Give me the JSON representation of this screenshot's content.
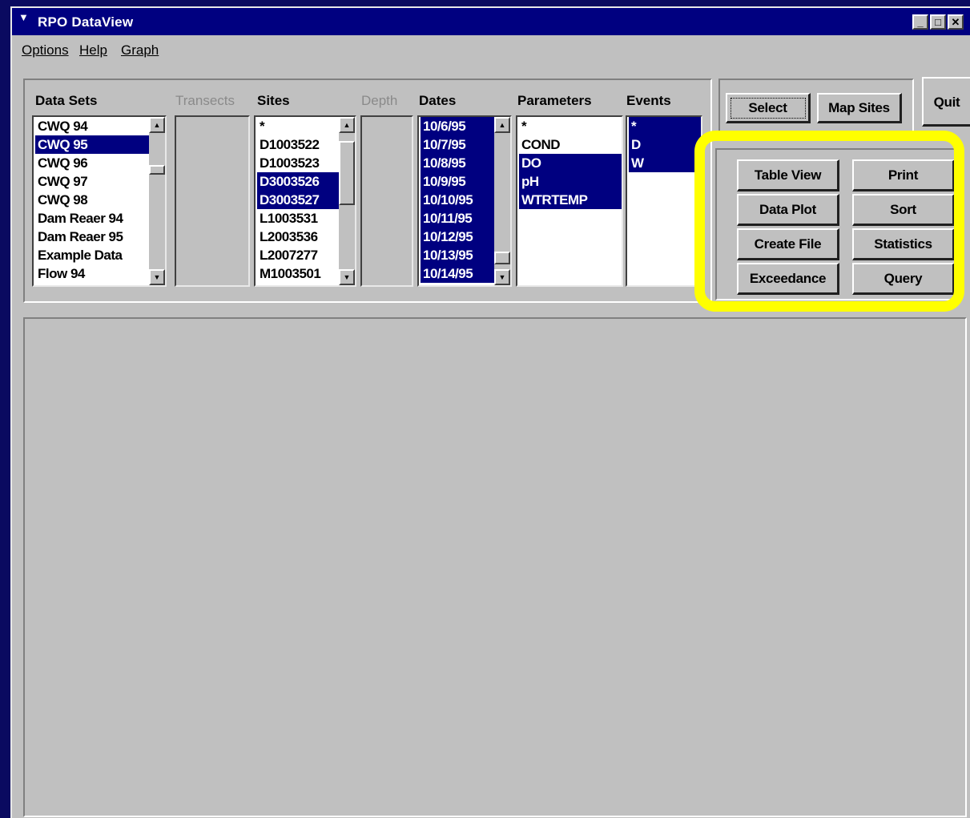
{
  "window": {
    "title": "RPO DataView",
    "controls": [
      "_",
      "□",
      "✕"
    ]
  },
  "menu": [
    "Options",
    "Help",
    "Graph"
  ],
  "columns": {
    "data_sets": {
      "label": "Data Sets",
      "items": [
        "CWQ 94",
        "CWQ 95",
        "CWQ 96",
        "CWQ 97",
        "CWQ 98",
        "Dam Reaer 94",
        "Dam Reaer 95",
        "Example Data",
        "Flow 94"
      ],
      "selected": [
        1
      ]
    },
    "transects": {
      "label": "Transects"
    },
    "sites": {
      "label": "Sites",
      "items": [
        "*",
        "D1003522",
        "D1003523",
        "D3003526",
        "D3003527",
        "L1003531",
        "L2003536",
        "L2007277",
        "M1003501"
      ],
      "selected": [
        3,
        4
      ]
    },
    "depth": {
      "label": "Depth"
    },
    "dates": {
      "label": "Dates",
      "items": [
        "10/6/95",
        "10/7/95",
        "10/8/95",
        "10/9/95",
        "10/10/95",
        "10/11/95",
        "10/12/95",
        "10/13/95",
        "10/14/95"
      ],
      "selected": [
        0,
        1,
        2,
        3,
        4,
        5,
        6,
        7,
        8
      ]
    },
    "parameters": {
      "label": "Parameters",
      "items": [
        "*",
        "COND",
        "DO",
        "pH",
        "WTRTEMP"
      ],
      "selected": [
        2,
        3,
        4
      ]
    },
    "events": {
      "label": "Events",
      "items": [
        "*",
        "D",
        "W"
      ],
      "selected": [
        0,
        1,
        2
      ]
    }
  },
  "buttons": {
    "select": "Select",
    "map_sites": "Map Sites",
    "quit": "Quit",
    "table_view": "Table View",
    "print": "Print",
    "data_plot": "Data Plot",
    "sort": "Sort",
    "create_file": "Create File",
    "statistics": "Statistics",
    "exceedance": "Exceedance",
    "query": "Query"
  },
  "colors": {
    "selection": "#000080",
    "highlight_ring": "#ffff00"
  }
}
